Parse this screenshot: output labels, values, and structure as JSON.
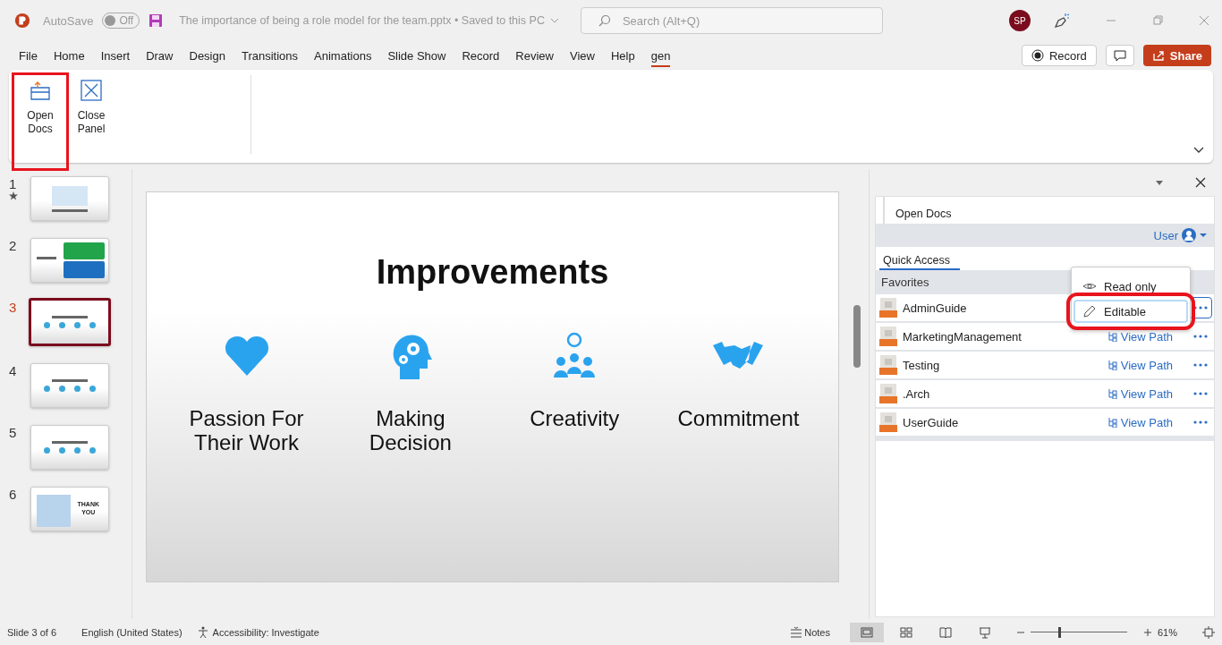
{
  "titlebar": {
    "autosave_label": "AutoSave",
    "autosave_state": "Off",
    "autosave_on": false,
    "doc_title": "The importance of being a role model for the team.pptx • Saved to this PC",
    "search_placeholder": "Search (Alt+Q)",
    "avatar": "SP"
  },
  "menu_tabs": [
    {
      "label": "File",
      "selected": false
    },
    {
      "label": "Home",
      "selected": false
    },
    {
      "label": "Insert",
      "selected": false
    },
    {
      "label": "Draw",
      "selected": false
    },
    {
      "label": "Design",
      "selected": false
    },
    {
      "label": "Transitions",
      "selected": false
    },
    {
      "label": "Animations",
      "selected": false
    },
    {
      "label": "Slide Show",
      "selected": false
    },
    {
      "label": "Record",
      "selected": false
    },
    {
      "label": "Review",
      "selected": false
    },
    {
      "label": "View",
      "selected": false
    },
    {
      "label": "Help",
      "selected": false
    },
    {
      "label": "gen",
      "selected": true
    }
  ],
  "header_buttons": {
    "record": "Record",
    "share": "Share"
  },
  "ribbon": [
    {
      "kind": "open",
      "label": "Open\nDocs",
      "highlighted": true
    },
    {
      "kind": "close",
      "label": "Close\nPanel",
      "highlighted": false
    }
  ],
  "thumbnails": [
    {
      "number": "1",
      "kind": "title",
      "selected": false,
      "starred": true
    },
    {
      "number": "2",
      "kind": "boxes",
      "selected": false,
      "starred": false
    },
    {
      "number": "3",
      "kind": "icons",
      "selected": true,
      "starred": false
    },
    {
      "number": "4",
      "kind": "icons",
      "selected": false,
      "starred": false
    },
    {
      "number": "5",
      "kind": "icons",
      "selected": false,
      "starred": false
    },
    {
      "number": "6",
      "kind": "thanks",
      "selected": false,
      "starred": false,
      "text": "THANK\nYOU"
    }
  ],
  "slide": {
    "title": "Improvements",
    "items": [
      {
        "kind": "heart",
        "label": "Passion For\nTheir Work"
      },
      {
        "kind": "head",
        "label": "Making\nDecision"
      },
      {
        "kind": "team",
        "label": "Creativity"
      },
      {
        "kind": "handshake",
        "label": "Commitment"
      }
    ]
  },
  "pane": {
    "title": "Open Docs",
    "user": "User",
    "tab": "Quick Access",
    "section": "Favorites",
    "rows": [
      {
        "name": "AdminGuide",
        "focused": true
      },
      {
        "name": "MarketingManagement",
        "view_path": "View Path",
        "focused": false
      },
      {
        "name": "Testing",
        "view_path": "View Path",
        "focused": false
      },
      {
        "name": ".Arch",
        "view_path": "View Path",
        "focused": false
      },
      {
        "name": "UserGuide",
        "view_path": "View Path",
        "focused": false
      }
    ],
    "menu": [
      {
        "kind": "eye",
        "label": "Read only",
        "selected": false,
        "highlighted": false
      },
      {
        "kind": "pencil",
        "label": "Editable",
        "selected": true,
        "highlighted": true
      }
    ]
  },
  "status": {
    "slide": "Slide 3 of 6",
    "language": "English (United States)",
    "accessibility": "Accessibility: Investigate",
    "notes": "Notes",
    "views": [
      {
        "kind": "normal",
        "selected": true
      },
      {
        "kind": "sorter",
        "selected": false
      },
      {
        "kind": "reading",
        "selected": false
      },
      {
        "kind": "show",
        "selected": false
      }
    ],
    "zoom": {
      "level": 0.29
    },
    "zoom_text": "61%"
  }
}
